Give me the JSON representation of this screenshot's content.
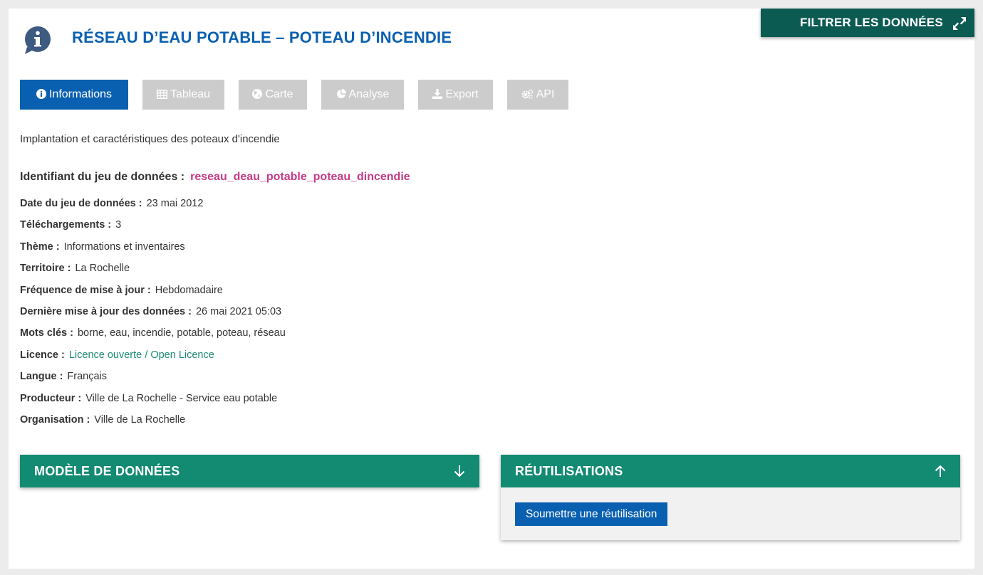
{
  "header": {
    "title": "RÉSEAU D’EAU POTABLE – POTEAU D’INCENDIE",
    "filter_button": "FILTRER LES DONNÉES"
  },
  "tabs": [
    {
      "label": "Informations",
      "icon": "info-circle-icon",
      "active": true
    },
    {
      "label": "Tableau",
      "icon": "table-icon",
      "active": false
    },
    {
      "label": "Carte",
      "icon": "globe-icon",
      "active": false
    },
    {
      "label": "Analyse",
      "icon": "pie-chart-icon",
      "active": false
    },
    {
      "label": "Export",
      "icon": "download-icon",
      "active": false
    },
    {
      "label": "API",
      "icon": "cogs-icon",
      "active": false
    }
  ],
  "description": "Implantation et caractéristiques des poteaux d'incendie",
  "identifier": {
    "label": "Identifiant du jeu de données :",
    "value": "reseau_deau_potable_poteau_dincendie"
  },
  "metadata": [
    {
      "label": "Date du jeu de données :",
      "value": "23 mai 2012"
    },
    {
      "label": "Téléchargements :",
      "value": "3"
    },
    {
      "label": "Thème :",
      "value": "Informations et inventaires"
    },
    {
      "label": "Territoire :",
      "value": "La Rochelle"
    },
    {
      "label": "Fréquence de mise à jour :",
      "value": "Hebdomadaire"
    },
    {
      "label": "Dernière mise à jour des données :",
      "value": "26 mai 2021 05:03"
    },
    {
      "label": "Mots clés :",
      "value": "borne, eau, incendie, potable, poteau, réseau"
    },
    {
      "label": "Licence :",
      "value": "Licence ouverte / Open Licence"
    },
    {
      "label": "Langue :",
      "value": "Français"
    },
    {
      "label": "Producteur :",
      "value": "Ville de La Rochelle - Service eau potable"
    },
    {
      "label": "Organisation :",
      "value": "Ville de La Rochelle"
    }
  ],
  "panels": {
    "model": {
      "title": "MODÈLE DE DONNÉES"
    },
    "reuses": {
      "title": "RÉUTILISATIONS",
      "submit_label": "Soumettre une réutilisation"
    }
  },
  "colors": {
    "primary_blue": "#0a60b0",
    "dark_teal": "#0c5b53",
    "teal": "#138a72",
    "identifier_pink": "#c63b86",
    "link_green": "#1a8a72",
    "tab_inactive": "#cccccc"
  }
}
